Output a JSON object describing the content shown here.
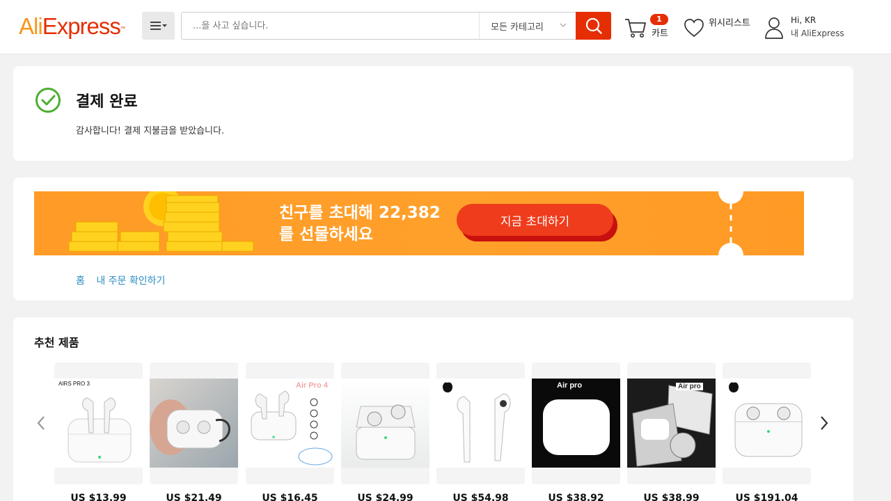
{
  "header": {
    "logo_ali": "Ali",
    "logo_express": "Express",
    "logo_tm": "™",
    "search_placeholder": "...을 사고 싶습니다.",
    "category": "모든 카테고리",
    "cart_count": "1",
    "cart_label": "카트",
    "wishlist_label": "위시리스트",
    "greeting": "Hi, KR",
    "my_account": "내 AliExpress"
  },
  "success": {
    "title": "결제 완료",
    "message": "감사합니다! 결제 지불금을 받았습니다."
  },
  "banner": {
    "text_line1": "친구를 초대해 22,382",
    "text_line2": "를 선물하세요",
    "button": "지금 초대하기"
  },
  "links": {
    "home": "홈",
    "orders": "내 주문 확인하기"
  },
  "recommend": {
    "title": "추천 제품",
    "products": [
      {
        "price": "US $13.99",
        "caption": "AIRS PRO 3"
      },
      {
        "price": "US $21.49"
      },
      {
        "price": "US $16.45",
        "caption": "Air Pro 4"
      },
      {
        "price": "US $24.99"
      },
      {
        "price": "US $54.98"
      },
      {
        "price": "US $38.92",
        "caption": "Air pro"
      },
      {
        "price": "US $38.99",
        "caption": "Air pro"
      },
      {
        "price": "US $191.04"
      }
    ]
  },
  "colors": {
    "brand_red": "#e62e04",
    "brand_orange": "#f7971e",
    "success_green": "#4caf2f",
    "link_blue": "#2a8ec4"
  }
}
